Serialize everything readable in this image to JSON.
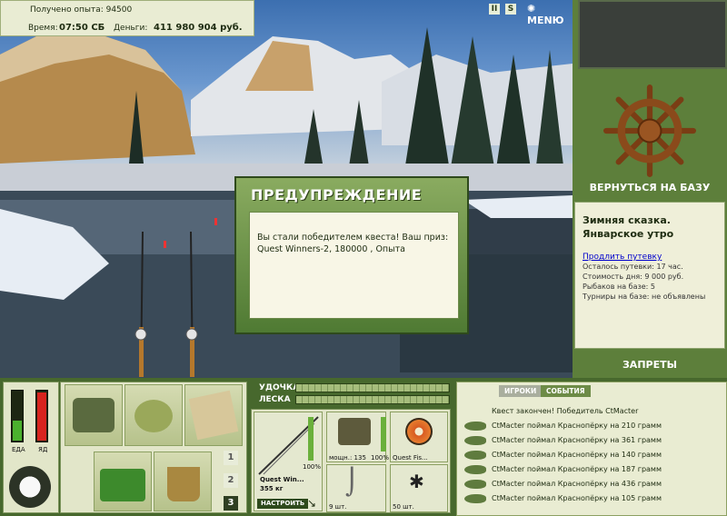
{
  "stats": {
    "experience_label": "Получено опыта: 94500",
    "time_label": "Время:",
    "time_value": "07:50 СБ",
    "money_label": "Деньги:",
    "money_value": "411 980 904 руб."
  },
  "toolbar": {
    "pause_label": "II",
    "sound_label": "S",
    "menu_label": "MENЮ"
  },
  "right_panel": {
    "return_label": "ВЕРНУТЬСЯ НА БАЗУ",
    "location_title": "Зимняя сказка. Январское утро",
    "extend_link": "Продлить путевку",
    "lines": [
      "Осталось путевки: 17 час.",
      "Стоимость дня: 9 000 руб.",
      "Рыбаков на базе: 5",
      "Турниры на базе: не объявлены"
    ],
    "bans_label": "ЗАПРЕТЫ"
  },
  "dialog": {
    "title": "ПРЕДУПРЕЖДЕНИЕ",
    "message": "Вы стали победителем квеста! Ваш приз: Quest Winners-2, 180000 , Опыта"
  },
  "gauges": {
    "food_label": "ЕДА",
    "poison_label": "ЯД",
    "food_level": 0.4,
    "poison_level": 0.95
  },
  "tackle": {
    "rod_label": "УДОЧКА",
    "line_label": "ЛЕСКА",
    "rod_name": "Quest Win...",
    "rod_weight": "355 кг",
    "rod_percent": "100%",
    "setup_label": "НАСТРОИТЬ",
    "reel_power": "мощн.: 135",
    "reel_percent": "100%",
    "line_name": "Quest Fis...",
    "hook_count": "9 шт.",
    "bait_count": "50 шт."
  },
  "pages": [
    "1",
    "2",
    "3"
  ],
  "chat": {
    "tab_players": "ИГРОКИ",
    "tab_events": "СОБЫТИЯ",
    "header_msg": "Квест закончен! Победитель CtMacter",
    "messages": [
      "CtMacter поймал Краснопёрку на 210 грамм",
      "CtMacter поймал Краснопёрку на 361 грамм",
      "CtMacter поймал Краснопёрку на 140 грамм",
      "CtMacter поймал Краснопёрку на 187 грамм",
      "CtMacter поймал Краснопёрку на 436 грамм",
      "CtMacter поймал Краснопёрку на 105 грамм"
    ]
  }
}
